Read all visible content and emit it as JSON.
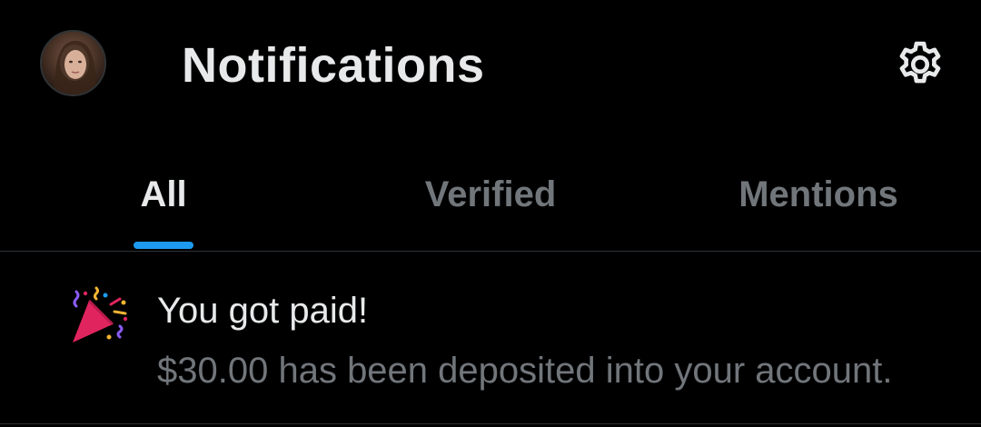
{
  "header": {
    "title": "Notifications",
    "avatar_icon": "user-avatar",
    "settings_icon": "gear-icon"
  },
  "tabs": [
    {
      "label": "All",
      "active": true
    },
    {
      "label": "Verified",
      "active": false
    },
    {
      "label": "Mentions",
      "active": false
    }
  ],
  "notification": {
    "icon": "party-popper-icon",
    "title": "You got paid!",
    "body": "$30.00 has been deposited into your account."
  },
  "colors": {
    "background": "#000000",
    "text_primary": "#e7e9ea",
    "text_secondary": "#71767b",
    "accent": "#1d9bf0",
    "divider": "#2f3336"
  }
}
